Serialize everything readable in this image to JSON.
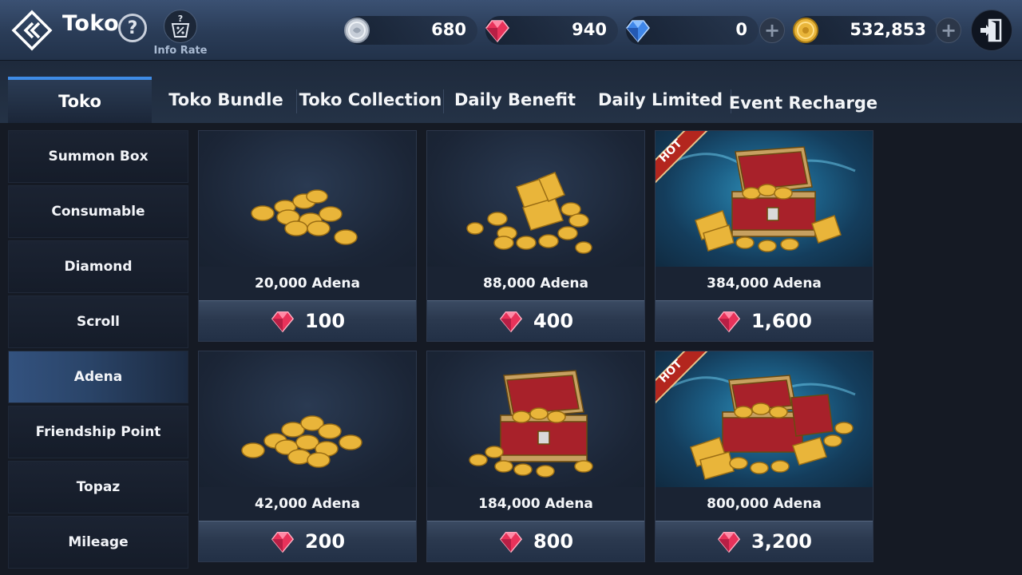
{
  "header": {
    "title": "Toko",
    "help_symbol": "?",
    "info_rate_label": "Info Rate",
    "info_rate_symbol": "?"
  },
  "currencies": [
    {
      "name": "silver-coin",
      "value": "680"
    },
    {
      "name": "red-gem",
      "value": "940"
    },
    {
      "name": "blue-diamond",
      "value": "0"
    },
    {
      "name": "gold-adena",
      "value": "532,853"
    }
  ],
  "plus_symbol": "+",
  "tabs": [
    {
      "label": "Toko",
      "active": true
    },
    {
      "label": "Toko Bundle"
    },
    {
      "label": "Toko Collection"
    },
    {
      "label": "Daily Benefit"
    },
    {
      "label": "Daily Limited"
    },
    {
      "label": "Event Recharge"
    }
  ],
  "sidebar": {
    "items": [
      {
        "label": "Summon Box"
      },
      {
        "label": "Consumable"
      },
      {
        "label": "Diamond"
      },
      {
        "label": "Scroll"
      },
      {
        "label": "Adena",
        "active": true
      },
      {
        "label": "Friendship Point"
      },
      {
        "label": "Topaz"
      },
      {
        "label": "Mileage"
      }
    ]
  },
  "products": [
    {
      "name": "20,000 Adena",
      "price": "100",
      "hot": false,
      "art": "coins-small"
    },
    {
      "name": "88,000 Adena",
      "price": "400",
      "hot": false,
      "art": "gold-bars-coins"
    },
    {
      "name": "384,000 Adena",
      "price": "1,600",
      "hot": true,
      "art": "chest-bars"
    },
    {
      "name": "42,000 Adena",
      "price": "200",
      "hot": false,
      "art": "coins-pile"
    },
    {
      "name": "184,000 Adena",
      "price": "800",
      "hot": false,
      "art": "chest"
    },
    {
      "name": "800,000 Adena",
      "price": "3,200",
      "hot": true,
      "art": "chest-bars-large"
    }
  ],
  "hot_label": "HOT",
  "colors": {
    "accent": "#3f8ce6",
    "gem_red": "#e8325a",
    "gold": "#e9b53a",
    "hot_red": "#b3261e"
  }
}
